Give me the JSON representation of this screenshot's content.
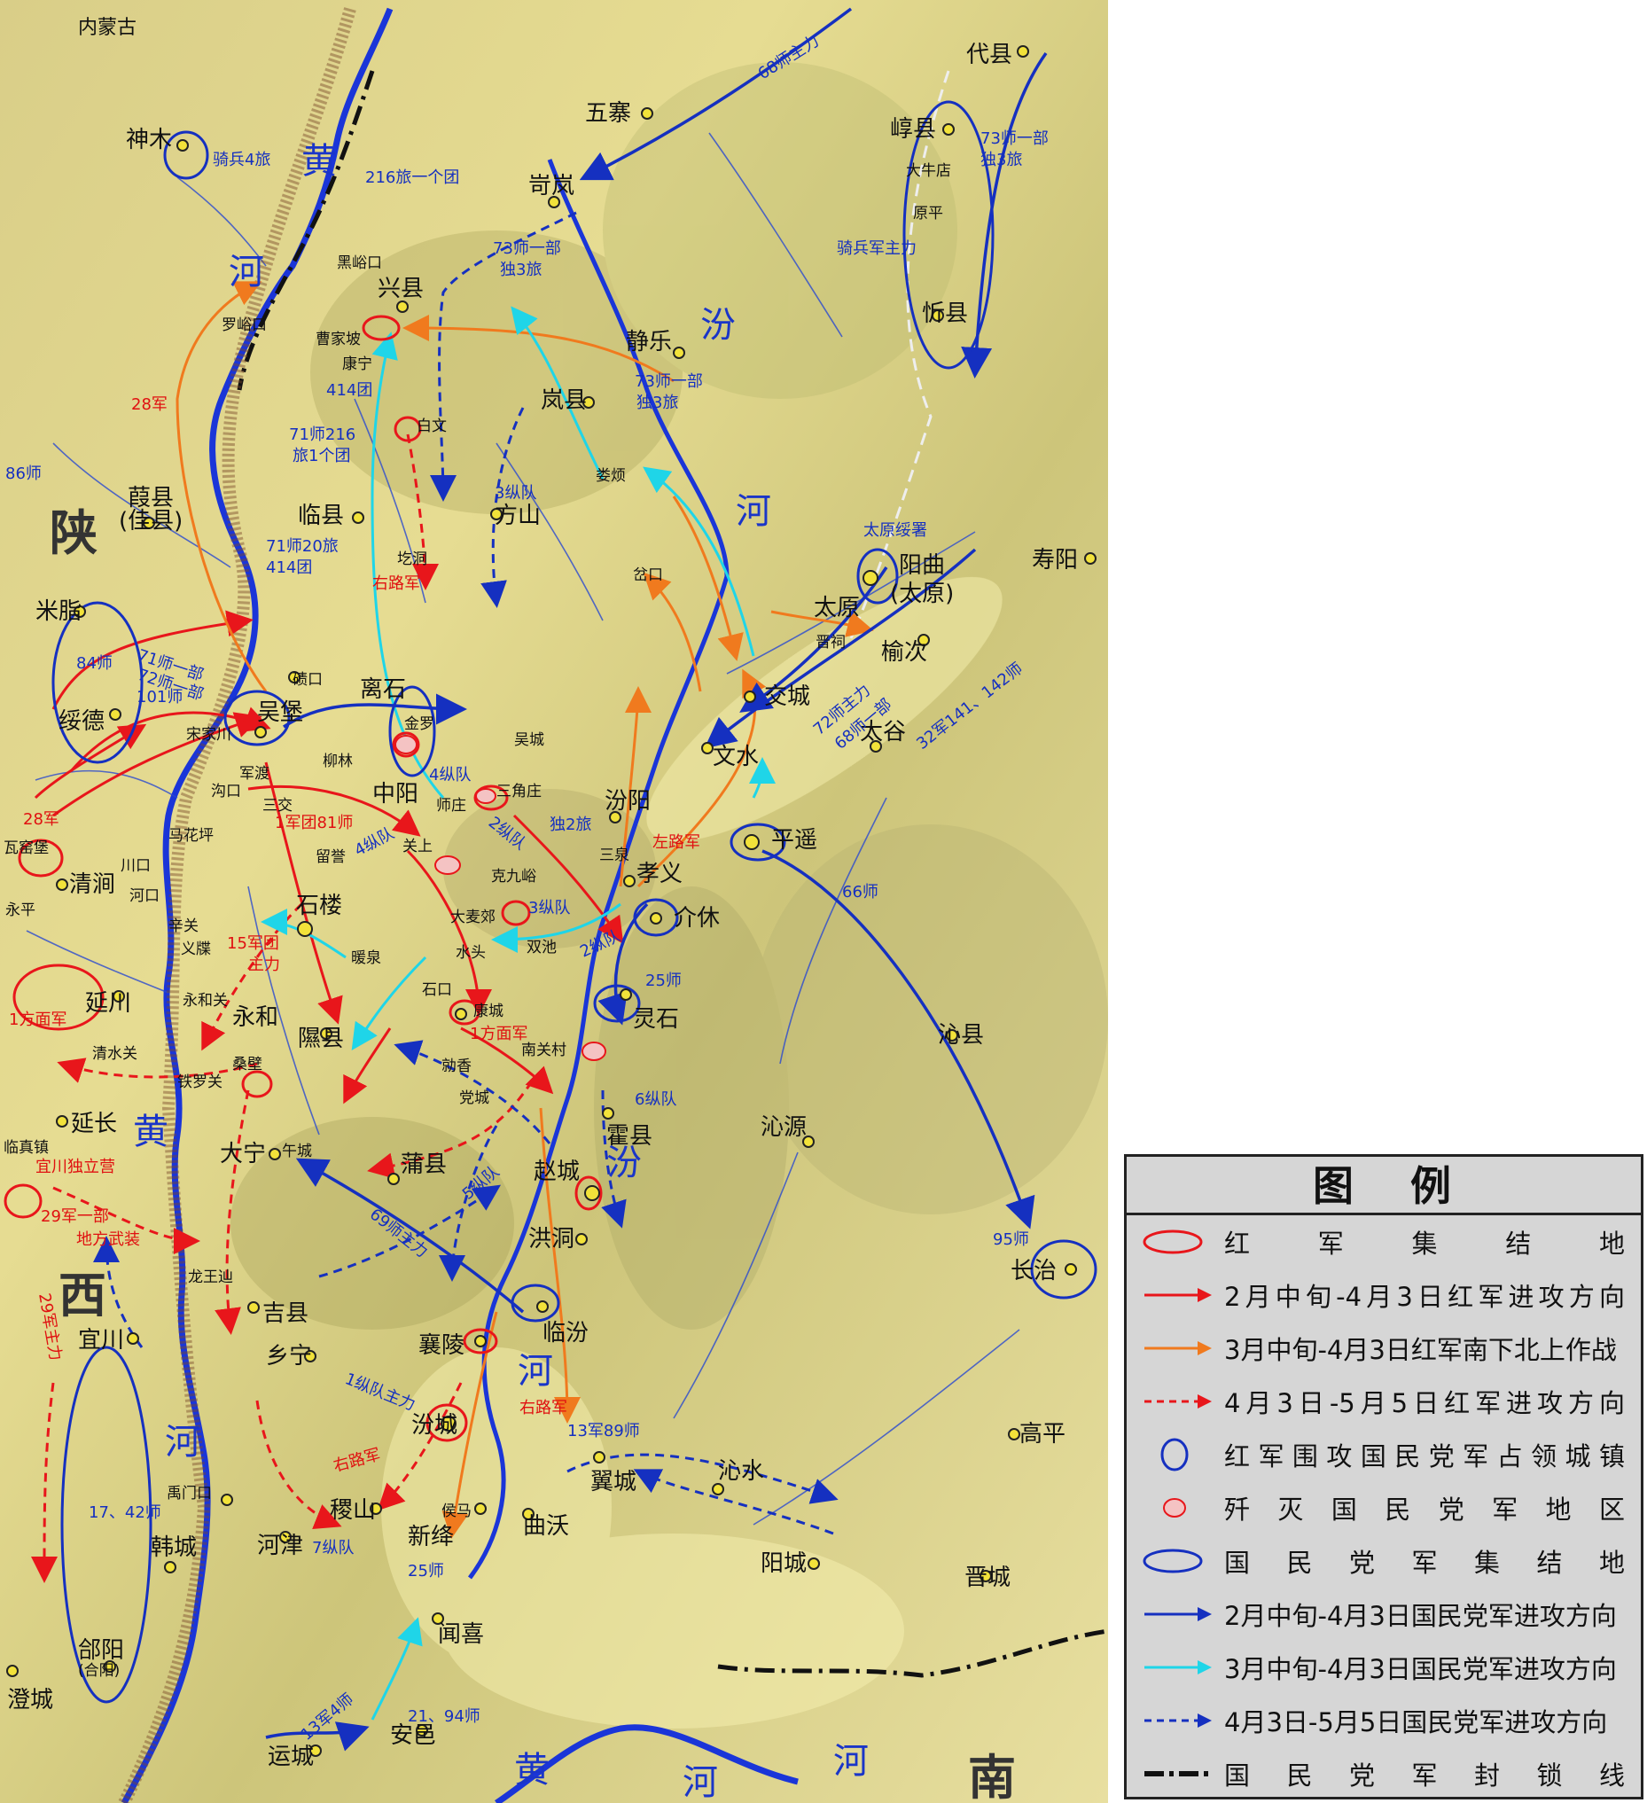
{
  "regions": {
    "neimenggu": "内蒙古",
    "shaan": "陕",
    "xi": "西",
    "henan": "南"
  },
  "rivers": {
    "huang1": "黄",
    "he1": "河",
    "fen": "汾",
    "he2": "河",
    "huang2": "黄",
    "fen2": "汾",
    "he3": "河",
    "he4": "河",
    "huang3": "黄",
    "he5": "河",
    "he6": "河"
  },
  "places": {
    "shenmu": "神木",
    "jiaxian": "葭县",
    "jiaxian2": "(佳县)",
    "mizhi": "米脂",
    "suide": "绥德",
    "qingjian": "清涧",
    "yongping": "永平",
    "yanchuan": "延川",
    "yanchang": "延长",
    "yichuan": "宜川",
    "hancheng": "韩城",
    "heyang": "郃阳",
    "heyang2": "(合阳)",
    "chengcheng": "澄城",
    "linzhen": "临真镇",
    "waiyaobao": "瓦窑堡",
    "wuzhai": "五寨",
    "kelan": "岢岚",
    "daixian": "代县",
    "yuanping_xian": "崞县",
    "daniudian": "大牛店",
    "yuanping": "原平",
    "xinxian": "忻县",
    "xingxian": "兴县",
    "heiyukou": "黑峪口",
    "luoyukou": "罗峪口",
    "caojiapo": "曹家坡",
    "kangning": "康宁",
    "jingle": "静乐",
    "lanxian": "岚县",
    "baiwen": "白文",
    "loufan": "娄烦",
    "linxian": "临县",
    "fangshan": "方山",
    "gedong": "圪洞",
    "gukou": "岔口",
    "taiyuan": "太原",
    "yangqu": "阳曲",
    "yangqu2": "(太原)",
    "jinci": "晋祠",
    "shouyang": "寿阳",
    "yuci": "榆次",
    "taigu": "太谷",
    "jiaocheng": "交城",
    "wenshui": "文水",
    "qikou": "碛口",
    "wubao": "吴堡",
    "songjiachuan": "宋家川",
    "lishi": "离石",
    "jinluo": "金罗",
    "liulin": "柳林",
    "wucheng": "吴城",
    "junqudu": "军渡",
    "goukou": "沟口",
    "sanjiao": "三交",
    "zhongyang": "中阳",
    "shizhuang": "师庄",
    "sanjiaozhuang": "三角庄",
    "fenyang": "汾阳",
    "sanquan": "三泉",
    "xiaoyi": "孝义",
    "pingyao": "平遥",
    "jiexiu": "介休",
    "mahuaping": "马花坪",
    "chuankou": "川口",
    "hekou": "河口",
    "liujin": "留誉",
    "guanshang": "关上",
    "kejiuyu": "克九峪",
    "xinguan": "辛关",
    "yidie": "义牒",
    "shilou": "石楼",
    "nuanquan": "暖泉",
    "damaijiao": "大麦郊",
    "shuitou": "水头",
    "shuangchi": "双池",
    "shikou": "石口",
    "kangcheng": "康城",
    "lingshi": "灵石",
    "nanguancun": "南关村",
    "yonghe": "永和",
    "yongheguan": "永和关",
    "qingshuiguan": "清水关",
    "tieluoguan": "铁罗关",
    "sangbi": "桑壁",
    "xixian": "隰县",
    "qinxian": "沁县",
    "qinyuan": "沁源",
    "quxiang": "勍香",
    "dangcheng": "党城",
    "huoxian": "霍县",
    "zhaocheng": "赵城",
    "puxian": "蒲县",
    "daning": "大宁",
    "wucheng2": "午城",
    "hongdong": "洪洞",
    "changzhi": "长治",
    "longwangshan": "龙王辿",
    "jixian": "吉县",
    "linfen": "临汾",
    "xiangling": "襄陵",
    "xiangning": "乡宁",
    "fencheng": "汾城",
    "gaoping": "高平",
    "yicheng": "翼城",
    "qinshui": "沁水",
    "jishan": "稷山",
    "houma": "侯马",
    "xinjiang": "新绛",
    "quwo": "曲沃",
    "yumenkou": "禹门口",
    "hejin": "河津",
    "yangcheng": "阳城",
    "jincheng": "晋城",
    "wenxi": "闻喜",
    "anyi": "安邑",
    "yuncheng": "运城"
  },
  "units": {
    "u68": "68师主力",
    "u73a": "73师一部",
    "u73b": "独3旅",
    "u216": "216旅一个团",
    "qibing4": "骑兵4旅",
    "u73c": "73师一部",
    "u73d": "独3旅",
    "qibingjun": "骑兵军主力",
    "u414": "414团",
    "u71216a": "71师216",
    "u71216b": "旅1个团",
    "u73e": "73师一部",
    "u73f": "独3旅",
    "u86": "86师",
    "u28a": "28军",
    "u3zd": "3纵队",
    "u7120a": "71师20旅",
    "u7120b": "414团",
    "youlu1": "右路军",
    "tyss": "太原绥署",
    "u84": "84师",
    "u71": "71师一部",
    "u72": "72师一部",
    "u101": "101师",
    "u72b": "72师主力",
    "u68b": "68师一部",
    "u32": "32军141、142师",
    "u28b": "28军",
    "u4zd": "4纵队",
    "u2zd": "2纵队",
    "du2": "独2旅",
    "zuolu": "左路军",
    "u1jt": "1军团81师",
    "u4zd2": "4纵队",
    "u3zd2": "3纵队",
    "u15": "15军团",
    "u15b": "主力",
    "u66": "66师",
    "u2zd2": "2纵队",
    "u25": "25师",
    "fm1a": "1方面军",
    "fm1b": "1方面军",
    "u6zd": "6纵队",
    "u5zd": "5纵队",
    "yc": "宜川独立营",
    "u29a": "29军一部",
    "u29b": "地方武装",
    "u69": "69师主力",
    "u95": "95师",
    "u29c": "29军主力",
    "u1zd": "1纵队主力",
    "youlu2": "右路军",
    "youlu3": "右路军",
    "u13": "13军89师",
    "u1742": "17、42师",
    "u7zd": "7纵队",
    "u25b": "25师",
    "u134": "13军4师",
    "u2194": "21、94师"
  },
  "legend": {
    "title": "图例",
    "items": [
      {
        "text": "红军集结地",
        "spread": true
      },
      {
        "text": "2月中旬-4月3日红军进攻方向",
        "spread": true
      },
      {
        "text": "3月中旬-4月3日红军南下北上作战",
        "spread": false
      },
      {
        "text": "4月3日-5月5日红军进攻方向",
        "spread": true
      },
      {
        "text": "红军围攻国民党军占领城镇",
        "spread": true
      },
      {
        "text": "歼灭国民党军地区",
        "spread": true
      },
      {
        "text": "国民党军集结地",
        "spread": true
      },
      {
        "text": "2月中旬-4月3日国民党军进攻方向",
        "spread": false
      },
      {
        "text": "3月中旬-4月3日国民党军进攻方向",
        "spread": false
      },
      {
        "text": "4月3日-5月5日国民党军进攻方向",
        "spread": false
      },
      {
        "text": "国民党军封锁线",
        "spread": true
      }
    ]
  },
  "colors": {
    "red": "#e8161b",
    "orange": "#f07a1e",
    "cyan": "#1fd5e8",
    "blue": "#1530c0",
    "terrain": "#e5d98c",
    "sea": "#f6efa8"
  }
}
